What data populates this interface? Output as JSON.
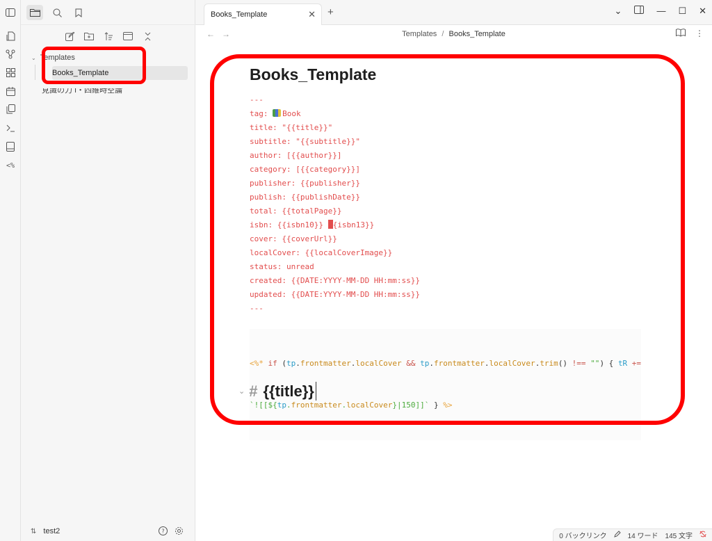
{
  "sidebar": {
    "folder": "Templates",
    "active_file": "Books_Template",
    "other_file": "見識の力 I・四維時空論",
    "vault_name": "test2"
  },
  "tab": {
    "title": "Books_Template",
    "close_glyph": "✕",
    "new_tab_glyph": "+"
  },
  "breadcrumb": {
    "folder": "Templates",
    "separator": "/",
    "file": "Books_Template"
  },
  "document": {
    "title": "Books_Template",
    "frontmatter": [
      "---",
      "tag: |Book",
      "title: \"{{title}}\"",
      "subtitle: \"{{subtitle}}\"",
      "author: [{{author}}]",
      "category: [{{category}}]",
      "publisher: {{publisher}}",
      "publish: {{publishDate}}",
      "total: {{totalPage}}",
      "isbn: {{isbn10}} |{isbn13}}",
      "cover: {{coverUrl}}",
      "localCover: {{localCoverImage}}",
      "status: unread",
      "created: {{DATE:YYYY-MM-DD HH:mm:ss}}",
      "updated: {{DATE:YYYY-MM-DD HH:mm:ss}}",
      "---"
    ],
    "tag_prefix": "tag: ",
    "tag_word": "Book",
    "isbn_prefix": "isbn: {{isbn10}} ",
    "isbn_suffix": "{isbn13}}",
    "template_line1": {
      "open": "<%*",
      "kw_if": " if ",
      "paren_open": "(",
      "tp1": "tp",
      "dot1": ".",
      "fm1": "frontmatter",
      "dot2": ".",
      "lc1": "localCover",
      "and": " && ",
      "tp2": "tp",
      "dot3": ".",
      "fm2": "frontmatter",
      "dot4": ".",
      "lc2": "localCover",
      "dot5": ".",
      "trim": "trim",
      "call": "()",
      "neq": " !== ",
      "empty": "\"\"",
      "rest": ") { ",
      "tR": "tR",
      "pluseq": " +="
    },
    "template_line2": {
      "start": "`![[${",
      "tp": "tp",
      "dot1": ".",
      "fm": "frontmatter",
      "dot2": ".",
      "lc": "localCover",
      "mid": "}|150]]`",
      "close_brace": " } ",
      "close": "%>"
    },
    "heading_hash": "#",
    "heading_text": "{{title}}"
  },
  "statusbar": {
    "backlinks": "0 バックリンク",
    "words": "14 ワード",
    "chars": "145 文字"
  },
  "colors": {
    "highlight": "#ff0000",
    "frontmatter_text": "#e24d4d"
  },
  "icons": {
    "ribbon": [
      "open-quick-switcher-icon",
      "graph-view-icon",
      "canvas-icon",
      "daily-note-icon",
      "templates-icon",
      "command-palette-icon",
      "book-icon",
      "templater-icon"
    ]
  }
}
